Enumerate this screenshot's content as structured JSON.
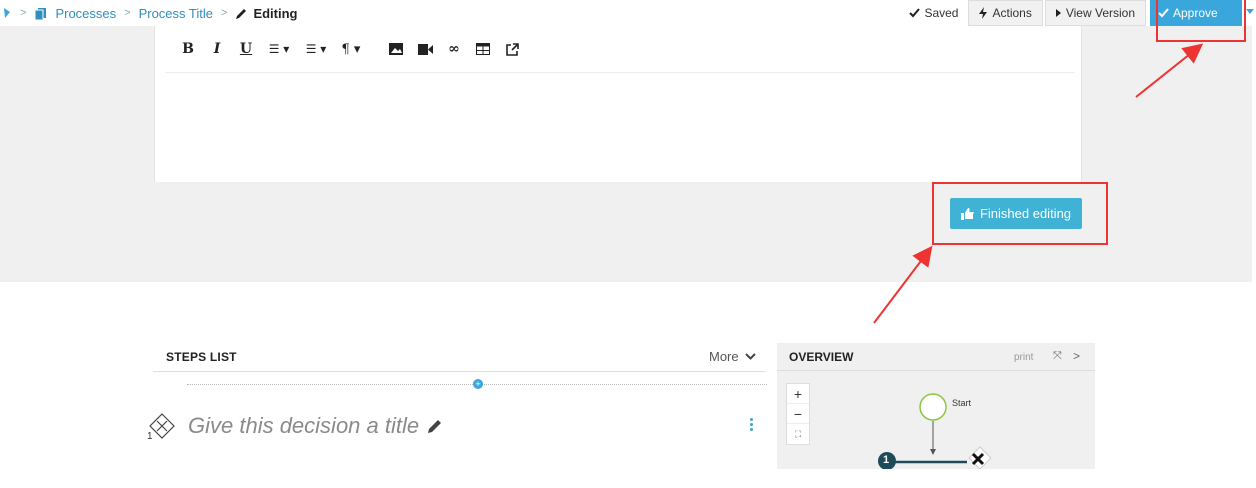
{
  "breadcrumb": {
    "items": [
      "Processes",
      "Process Title"
    ],
    "current": "Editing"
  },
  "toolbar_right": {
    "saved": "Saved",
    "actions": "Actions",
    "view_version": "View Version",
    "approve": "Approve"
  },
  "editor": {
    "tools": [
      {
        "name": "bold-tool",
        "glyph": "B"
      },
      {
        "name": "italic-tool",
        "glyph": "I"
      },
      {
        "name": "underline-tool",
        "glyph": "U"
      },
      {
        "name": "ordered-list-tool",
        "glyph": "≡▾"
      },
      {
        "name": "unordered-list-tool",
        "glyph": "≡▾"
      },
      {
        "name": "paragraph-tool",
        "glyph": "¶▾"
      },
      {
        "name": "image-tool",
        "glyph": "▣"
      },
      {
        "name": "video-tool",
        "glyph": "■"
      },
      {
        "name": "link-tool",
        "glyph": "🔗"
      },
      {
        "name": "table-tool",
        "glyph": "⊞"
      },
      {
        "name": "external-link-tool",
        "glyph": "⇗"
      }
    ],
    "finished_label": "Finished editing"
  },
  "steps": {
    "title": "STEPS LIST",
    "more": "More",
    "step_number": "1",
    "decision_title": "Give this decision a title"
  },
  "overview": {
    "title": "OVERVIEW",
    "print": "print",
    "start_label": "Start",
    "node_number": "1",
    "zoom_in": "+",
    "zoom_out": "−"
  },
  "colors": {
    "accent": "#3aa7dc",
    "finished_button": "#3fb2d6",
    "annotation_red": "#e33333",
    "start_node": "#8cc63f"
  }
}
